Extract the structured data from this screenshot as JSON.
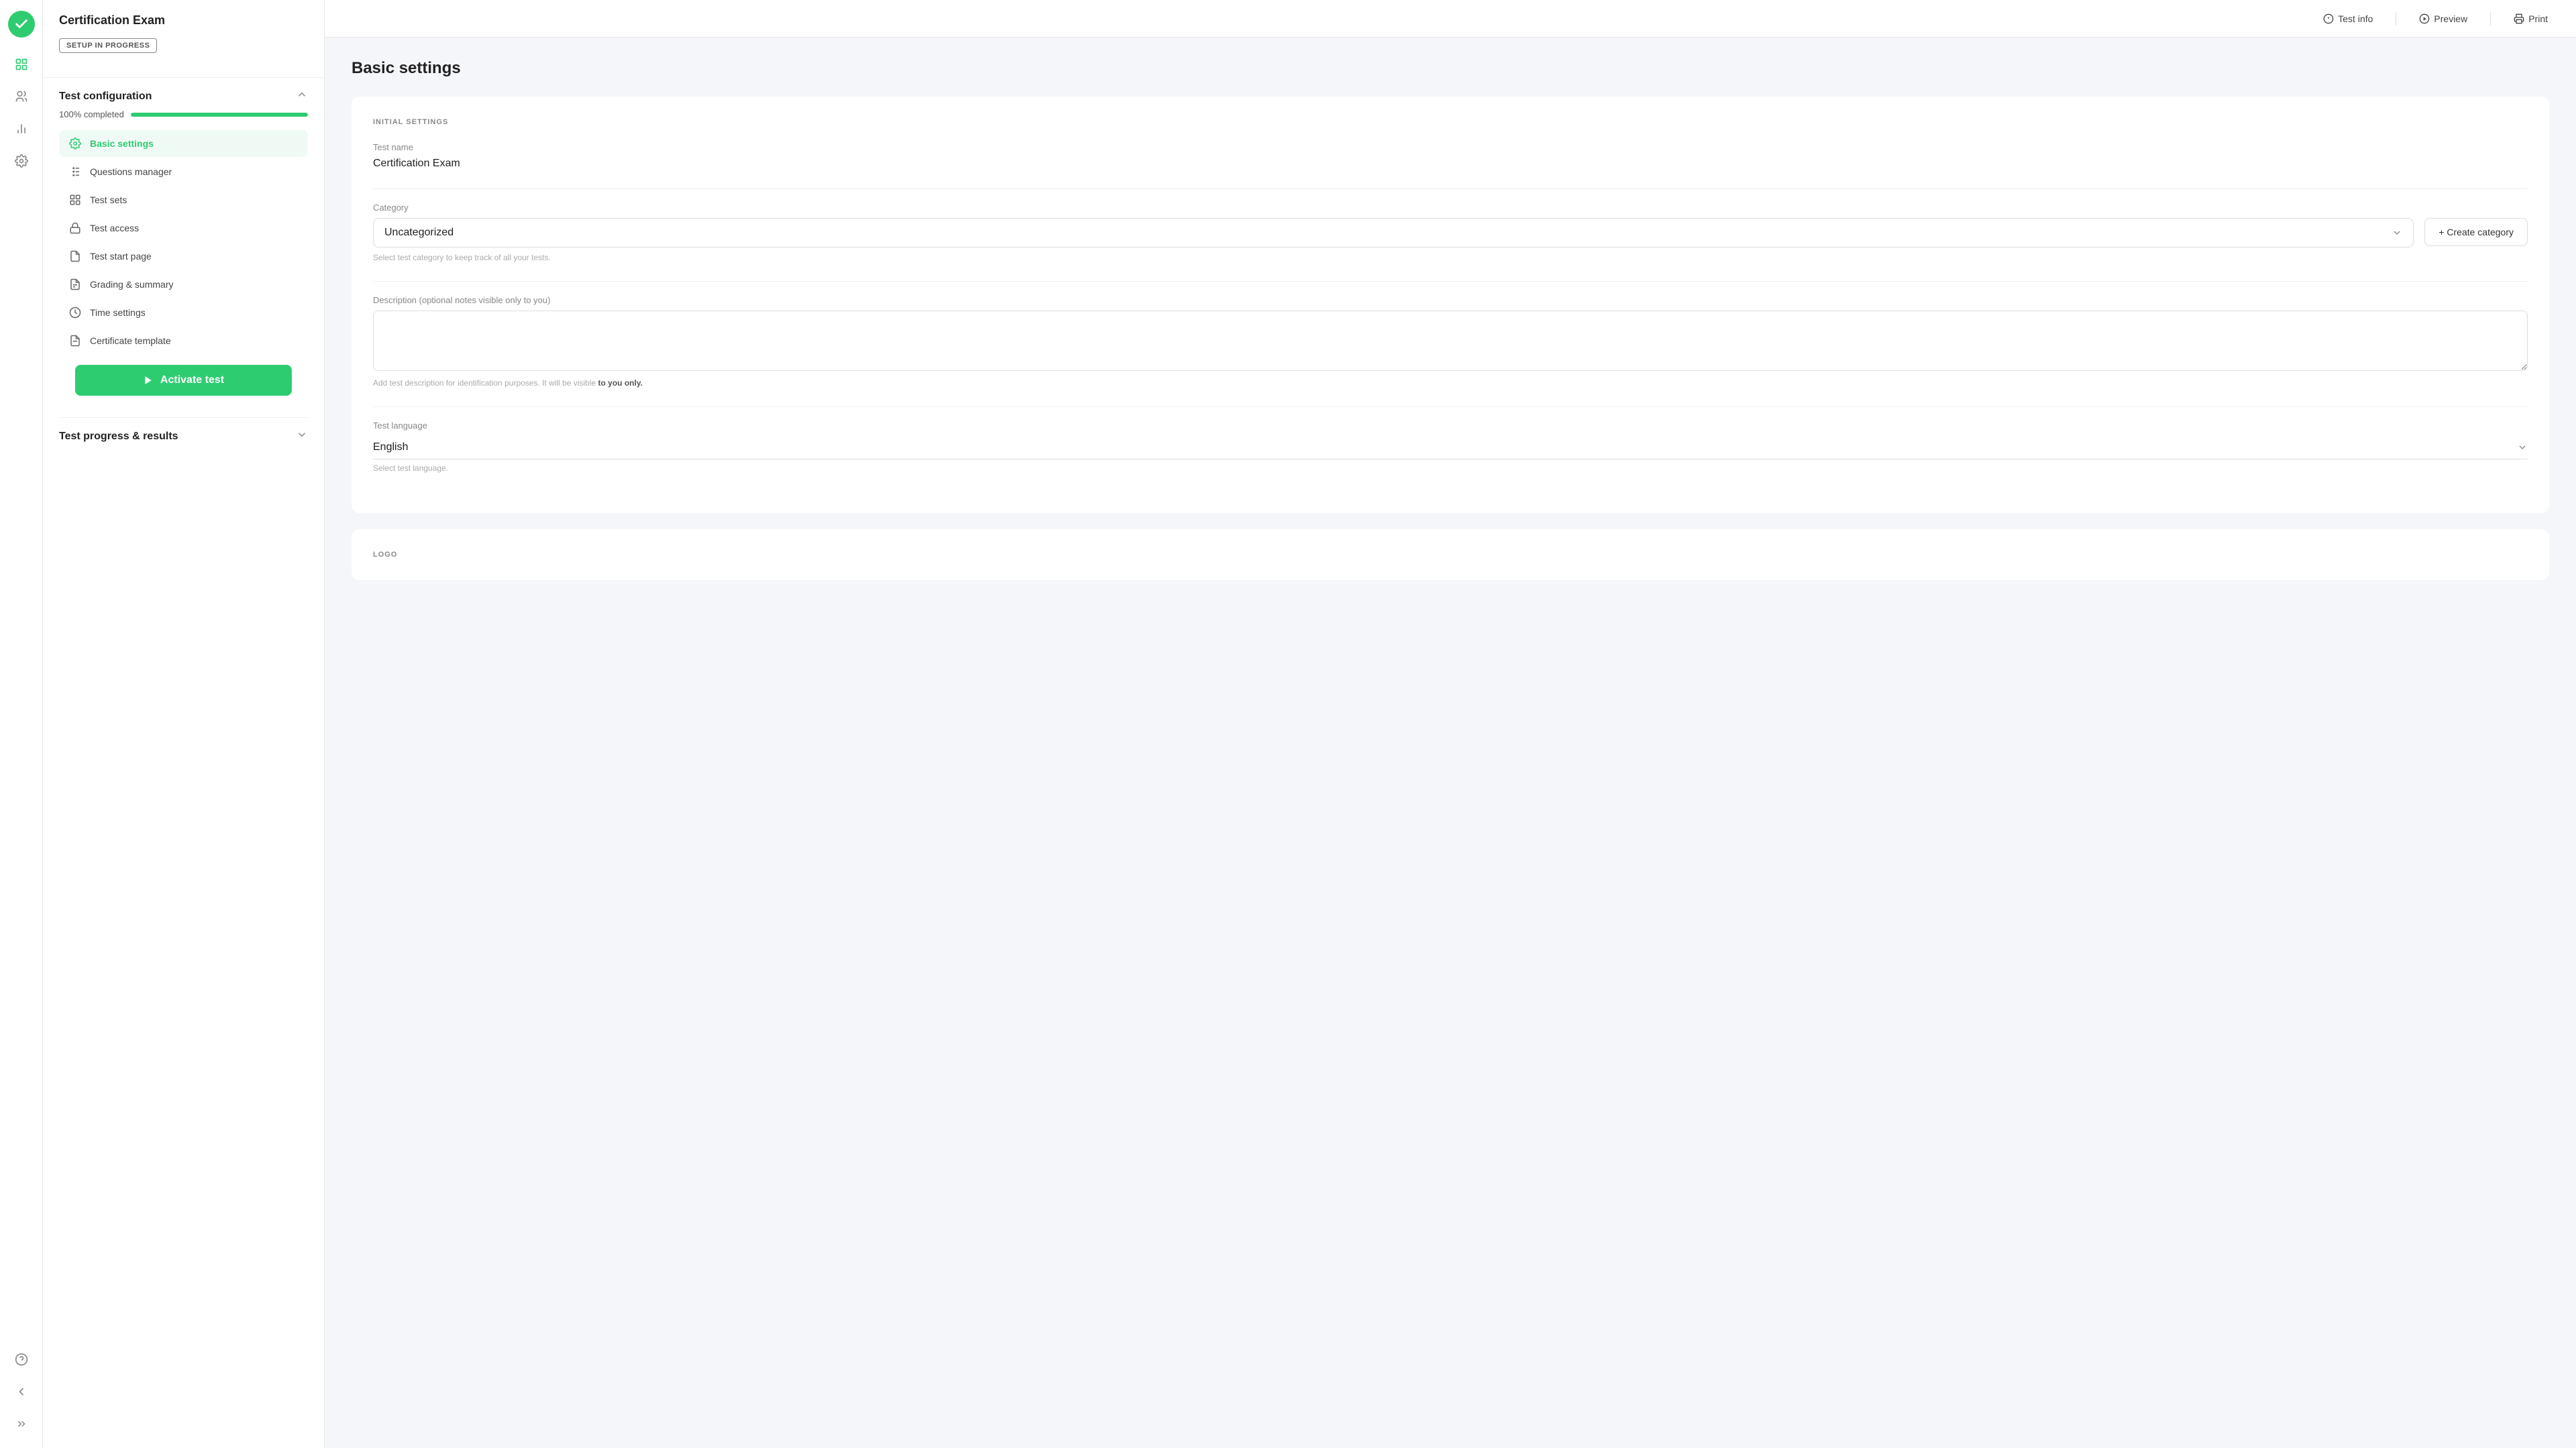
{
  "app": {
    "title": "Certification Exam",
    "logo_icon": "check-circle"
  },
  "top_bar": {
    "test_info_label": "Test info",
    "preview_label": "Preview",
    "print_label": "Print"
  },
  "sidebar": {
    "setup_badge": "SETUP IN PROGRESS",
    "config_section": {
      "title": "Test configuration",
      "progress_label": "100% completed",
      "progress_percent": 100
    },
    "nav_items": [
      {
        "id": "basic-settings",
        "label": "Basic settings",
        "icon": "settings",
        "active": true
      },
      {
        "id": "questions-manager",
        "label": "Questions manager",
        "icon": "questions",
        "active": false
      },
      {
        "id": "test-sets",
        "label": "Test sets",
        "icon": "sets",
        "active": false
      },
      {
        "id": "test-access",
        "label": "Test access",
        "icon": "access",
        "active": false
      },
      {
        "id": "test-start-page",
        "label": "Test start page",
        "icon": "start-page",
        "active": false
      },
      {
        "id": "grading-summary",
        "label": "Grading & summary",
        "icon": "grading",
        "active": false
      },
      {
        "id": "time-settings",
        "label": "Time settings",
        "icon": "time",
        "active": false
      },
      {
        "id": "certificate-template",
        "label": "Certificate template",
        "icon": "certificate",
        "active": false
      }
    ],
    "activate_btn": "Activate test",
    "test_progress_title": "Test progress & results"
  },
  "main": {
    "section_title": "Basic settings",
    "initial_settings_label": "INITIAL SETTINGS",
    "test_name_label": "Test name",
    "test_name_value": "Certification Exam",
    "category_label": "Category",
    "category_value": "Uncategorized",
    "category_hint": "Select test category to keep track of all your tests.",
    "create_category_btn": "+ Create category",
    "description_label": "Description (optional notes visible only to you)",
    "description_hint_text": "Add test description for identification purposes. It will be visible",
    "description_hint_bold": "to you only.",
    "language_label": "Test language",
    "language_value": "English",
    "language_hint": "Select test language.",
    "logo_section_label": "LOGO"
  }
}
